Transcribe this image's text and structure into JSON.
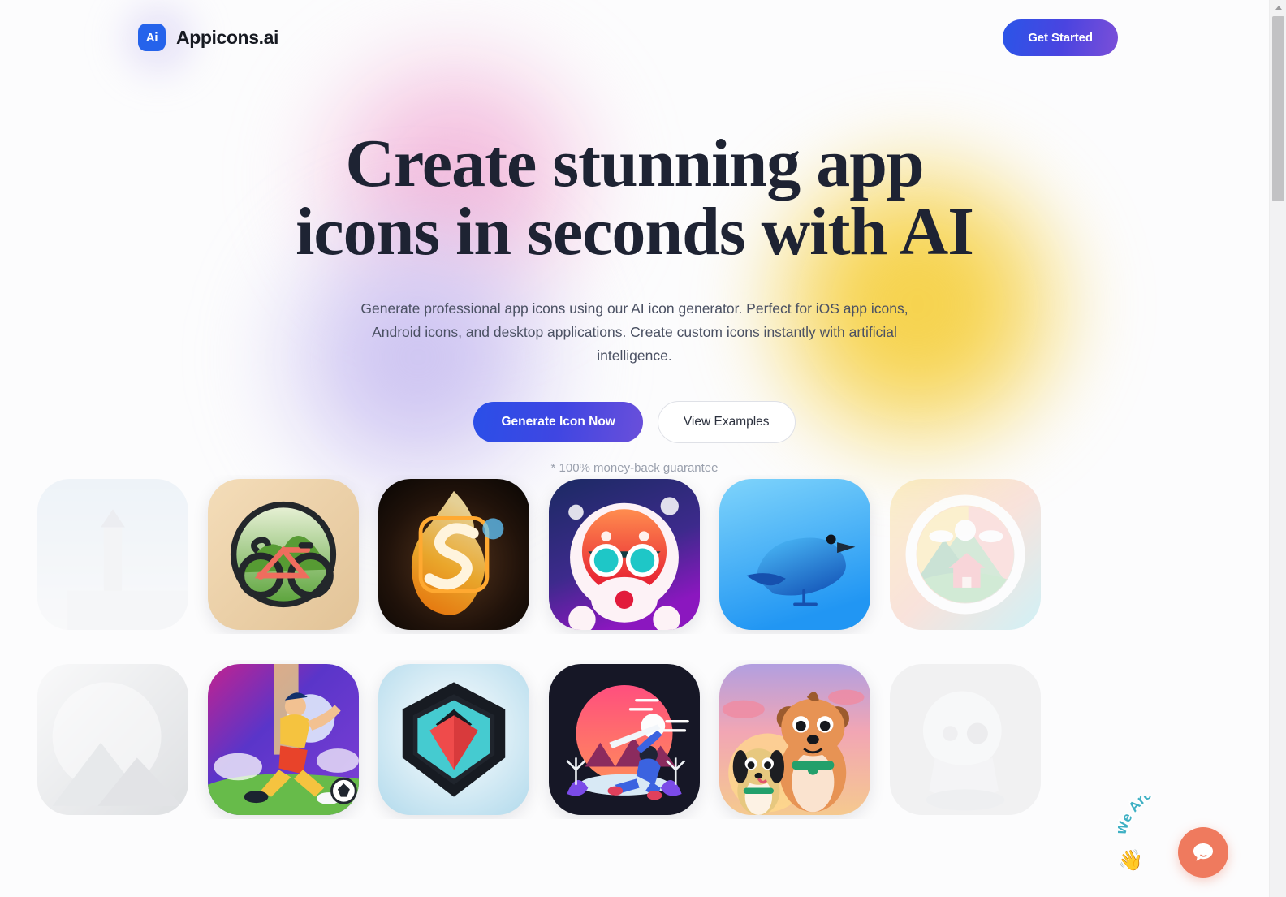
{
  "header": {
    "brand_mark": "Ai",
    "brand_name": "Appicons.ai",
    "cta_label": "Get Started"
  },
  "hero": {
    "title_line_1": "Create stunning app",
    "title_line_2": "icons in seconds with AI",
    "subtitle": "Generate professional app icons using our AI icon generator. Perfect for iOS app icons, Android icons, and desktop applications. Create custom icons instantly with artificial intelligence.",
    "primary_cta": "Generate Icon Now",
    "secondary_cta": "View Examples",
    "guarantee": "* 100% money-back guarantee"
  },
  "gallery": {
    "row_1": [
      {
        "name": "lighthouse-seaside-icon",
        "partial": true
      },
      {
        "name": "bicycle-hills-icon",
        "partial": false
      },
      {
        "name": "flaming-letter-s-icon",
        "partial": false
      },
      {
        "name": "red-mascot-sunglasses-icon",
        "partial": false
      },
      {
        "name": "blue-bird-icon",
        "partial": false
      },
      {
        "name": "mountain-cabin-circle-icon",
        "partial": true
      }
    ],
    "row_2": [
      {
        "name": "grey-mountain-sunrise-icon",
        "partial": true
      },
      {
        "name": "soccer-player-icon",
        "partial": false
      },
      {
        "name": "shield-emblem-icon",
        "partial": false
      },
      {
        "name": "samurai-sunset-icon",
        "partial": false
      },
      {
        "name": "bear-and-dog-icon",
        "partial": false
      },
      {
        "name": "boy-character-icon",
        "partial": true
      }
    ]
  },
  "chat_widget": {
    "label": "We Are Here!",
    "wave_icon": "waving-hand",
    "button_icon": "chat-bubble"
  },
  "colors": {
    "accent_blue": "#2563eb",
    "gradient_start": "#2a4fe8",
    "gradient_end": "#7b4fd8",
    "blob_pink": "#f3bede",
    "blob_purple": "#cfc6f2",
    "blob_yellow": "#f6d34f",
    "chat_orange": "#ef7a5e",
    "chat_label_teal": "#3fb0c4",
    "heading": "#1e2333",
    "body_text": "#4b5163",
    "muted_text": "#9aa0ad"
  }
}
